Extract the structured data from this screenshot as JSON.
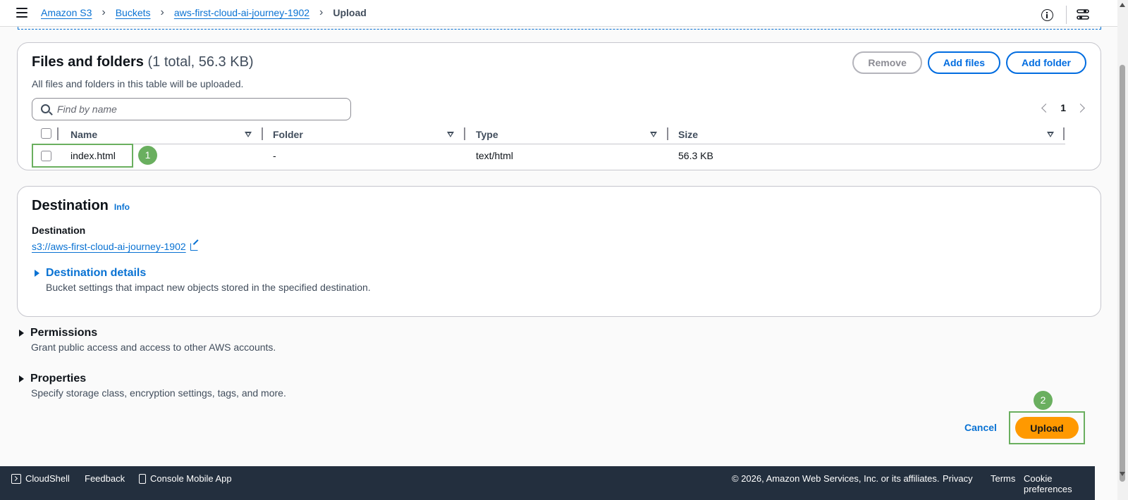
{
  "breadcrumb": {
    "items": [
      "Amazon S3",
      "Buckets",
      "aws-first-cloud-ai-journey-1902"
    ],
    "current": "Upload"
  },
  "files_panel": {
    "title": "Files and folders",
    "count": "(1 total, 56.3 KB)",
    "description": "All files and folders in this table will be uploaded.",
    "buttons": {
      "remove": "Remove",
      "add_files": "Add files",
      "add_folder": "Add folder"
    },
    "search_placeholder": "Find by name",
    "page": "1",
    "columns": [
      "Name",
      "Folder",
      "Type",
      "Size"
    ],
    "rows": [
      {
        "name": "index.html",
        "folder": "-",
        "type": "text/html",
        "size": "56.3 KB"
      }
    ],
    "step_badge": "1"
  },
  "destination_panel": {
    "title": "Destination",
    "info": "Info",
    "label": "Destination",
    "link": "s3://aws-first-cloud-ai-journey-1902",
    "details_title": "Destination details",
    "details_desc": "Bucket settings that impact new objects stored in the specified destination."
  },
  "permissions": {
    "title": "Permissions",
    "desc": "Grant public access and access to other AWS accounts."
  },
  "properties": {
    "title": "Properties",
    "desc": "Specify storage class, encryption settings, tags, and more."
  },
  "actions": {
    "cancel": "Cancel",
    "upload": "Upload",
    "step_badge": "2"
  },
  "footer": {
    "cloudshell": "CloudShell",
    "feedback": "Feedback",
    "mobile_app": "Console Mobile App",
    "copyright": "© 2026, Amazon Web Services, Inc. or its affiliates.",
    "privacy": "Privacy",
    "terms": "Terms",
    "cookies": "Cookie preferences"
  },
  "colors": {
    "link": "#0972d3",
    "primary_button": "#ff9900",
    "annotation": "#6aaf5f",
    "footer_bg": "#232f3e"
  }
}
